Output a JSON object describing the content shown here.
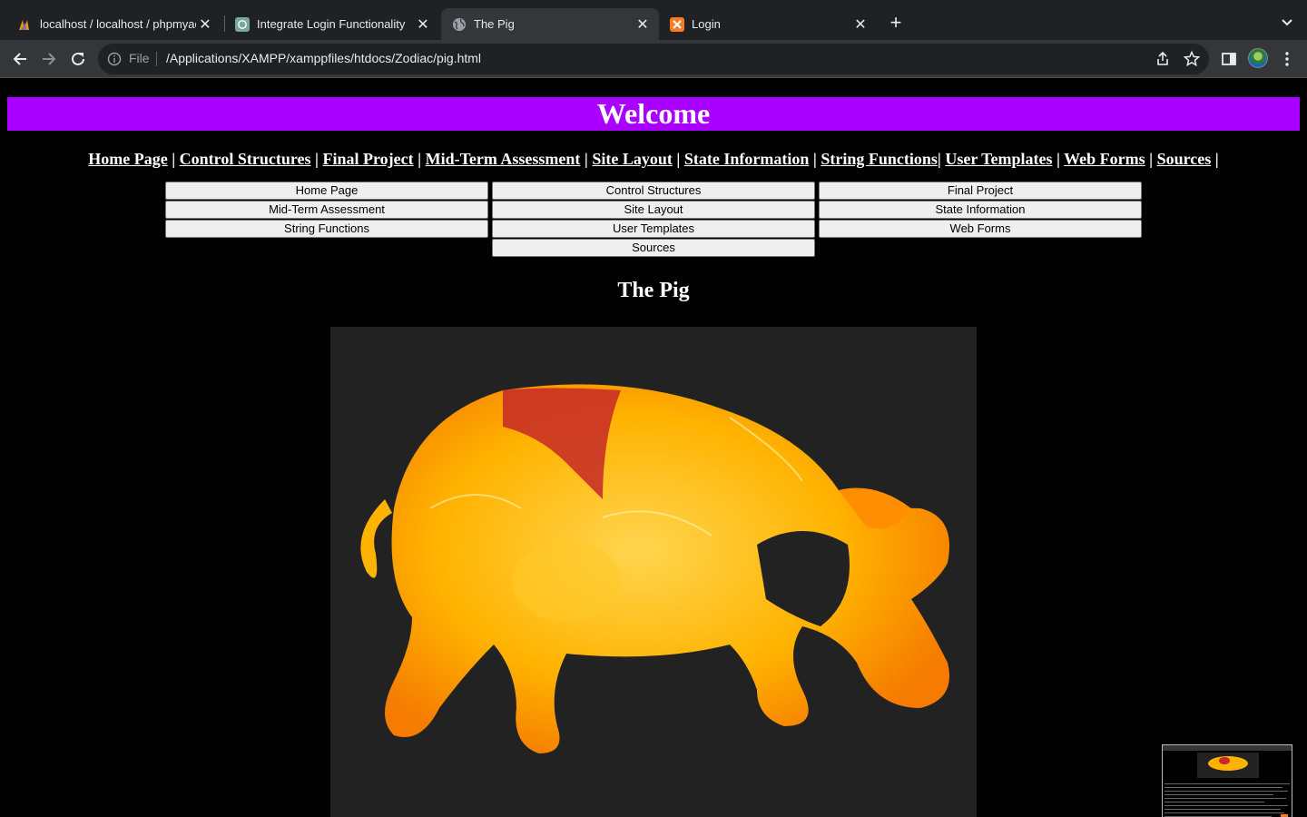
{
  "browser": {
    "tabs": [
      {
        "title": "localhost / localhost / phpmyadmin",
        "icon": "phpmyadmin-icon"
      },
      {
        "title": "Integrate Login Functionality",
        "icon": "chatgpt-icon"
      },
      {
        "title": "The Pig",
        "icon": "globe-icon",
        "active": true
      },
      {
        "title": "Login",
        "icon": "xampp-icon"
      }
    ],
    "omnibox": {
      "scheme_label": "File",
      "url": "/Applications/XAMPP/xamppfiles/htdocs/Zodiac/pig.html"
    }
  },
  "page": {
    "banner": "Welcome",
    "nav_links": [
      "Home Page",
      "Control Structures",
      "Final Project",
      "Mid-Term Assessment",
      "Site Layout",
      "State Information",
      "String Functions",
      "User Templates",
      "Web Forms",
      "Sources"
    ],
    "buttons": [
      "Home Page",
      "Control Structures",
      "Final Project",
      "Mid-Term Assessment",
      "Site Layout",
      "State Information",
      "String Functions",
      "User Templates",
      "Web Forms",
      "Sources"
    ],
    "title": "The Pig"
  },
  "colors": {
    "banner": "#aa00ff",
    "page_background": "#000000",
    "image_background": "#222222",
    "pig_primary": "#ffb300",
    "pig_accent": "#c62828"
  }
}
